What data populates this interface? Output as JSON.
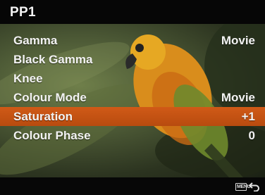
{
  "title": "PP1",
  "menu": {
    "items": [
      {
        "label": "Gamma",
        "value": "Movie"
      },
      {
        "label": "Black Gamma",
        "value": ""
      },
      {
        "label": "Knee",
        "value": ""
      },
      {
        "label": "Colour Mode",
        "value": "Movie"
      },
      {
        "label": "Saturation",
        "value": "+1"
      },
      {
        "label": "Colour Phase",
        "value": "0"
      }
    ],
    "selected_index": 4
  },
  "footer": {
    "menu_icon_text": "MENU",
    "return_icon": "return-arrow-icon"
  },
  "colors": {
    "highlight": "#c4531a",
    "title_bar": "#060606"
  }
}
